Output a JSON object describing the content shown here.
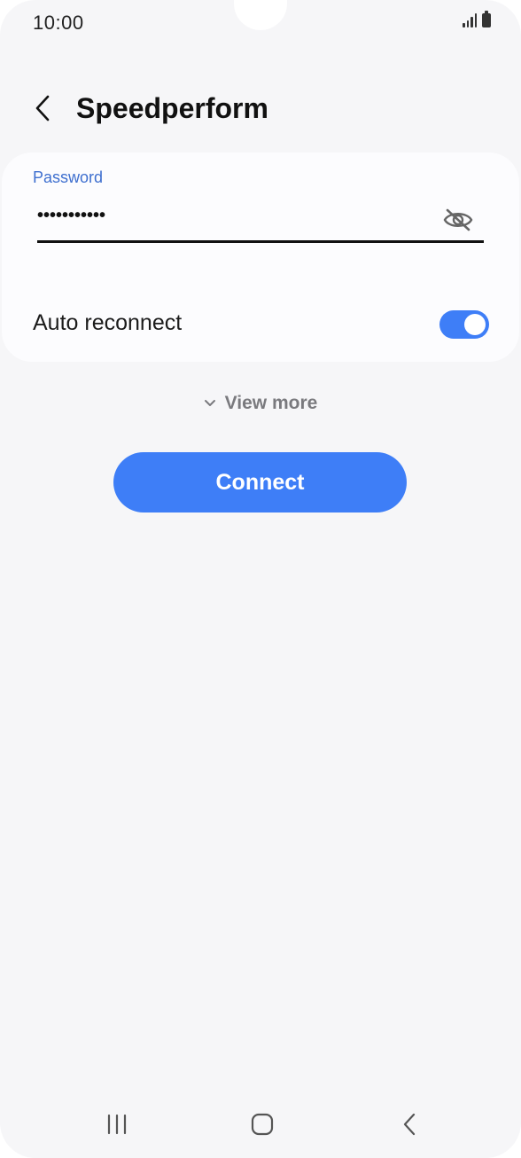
{
  "status_bar": {
    "time": "10:00",
    "icons": [
      "signal-icon",
      "battery-icon"
    ]
  },
  "header": {
    "title": "Speedperform",
    "back_icon": "chevron-left-icon"
  },
  "password": {
    "label": "Password",
    "value": "•••••••••••",
    "visibility_icon": "eye-off-icon"
  },
  "auto_reconnect": {
    "label": "Auto reconnect",
    "enabled": true
  },
  "view_more": {
    "label": "View more",
    "icon": "chevron-down-icon"
  },
  "connect": {
    "label": "Connect"
  },
  "nav": {
    "items": [
      "recent-apps-icon",
      "home-icon",
      "back-icon"
    ]
  },
  "colors": {
    "accent": "#3e7ef7",
    "label_blue": "#3e6fcf",
    "background": "#f6f6f8",
    "card": "#fcfcfe"
  }
}
